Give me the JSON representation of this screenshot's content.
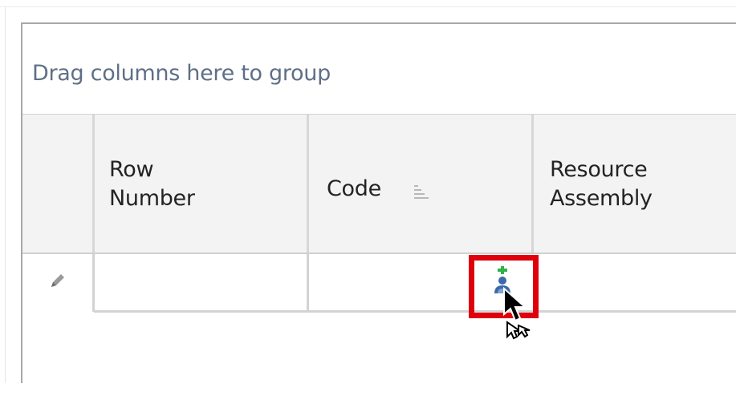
{
  "group_panel": {
    "text": "Drag columns here to group"
  },
  "columns": [
    {
      "label_line1": "Row",
      "label_line2": "Number"
    },
    {
      "label": "Code",
      "sort_icon": "sort-ascending-icon"
    },
    {
      "label_line1": "Resource",
      "label_line2": "Assembly"
    }
  ],
  "row": {
    "edit_icon": "pencil-icon",
    "drop_icon": "add-user-icon"
  },
  "colors": {
    "highlight_border": "#e0000b",
    "group_text": "#5f6f86",
    "header_background": "#f3f3f3"
  }
}
